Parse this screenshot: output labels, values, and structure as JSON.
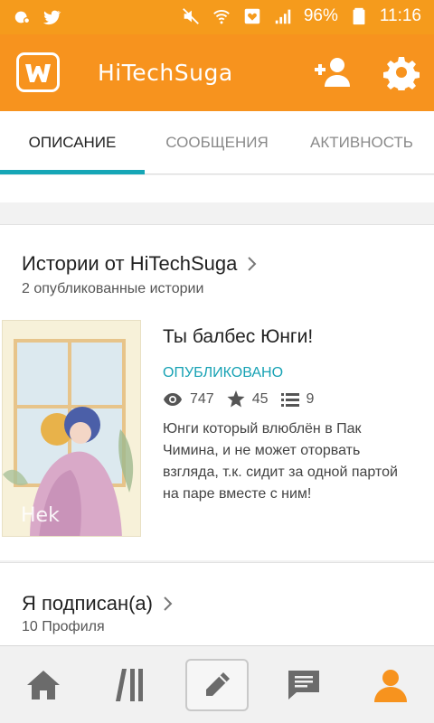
{
  "status_bar": {
    "battery": "96%",
    "time": "11:16"
  },
  "app_bar": {
    "title": "HiTechSuga"
  },
  "tabs": [
    {
      "label": "ОПИСАНИЕ",
      "active": true
    },
    {
      "label": "СООБЩЕНИЯ",
      "active": false
    },
    {
      "label": "АКТИВНОСТЬ",
      "active": false
    }
  ],
  "stories_section": {
    "title": "Истории от HiTechSuga",
    "subtitle": "2 опубликованные истории",
    "story": {
      "title": "Ты балбес Юнги!",
      "status": "ОПУБЛИКОВАНО",
      "views": "747",
      "votes": "45",
      "parts": "9",
      "description": "Юнги который влюблён в Пак Чимина, и не может оторвать взгляда, т.к. сидит за одной партой на паре вместе с ним!",
      "cover_text": "Hek"
    }
  },
  "following_section": {
    "title": "Я подписан(а)",
    "subtitle": "10 Профиля"
  },
  "bottom_nav": {
    "items": [
      "home-icon",
      "library-icon",
      "write-icon",
      "messages-icon",
      "profile-icon"
    ],
    "active": "profile-icon"
  },
  "colors": {
    "accent": "#f7931e",
    "status_bar": "#f59b1c",
    "teal": "#16a6b6",
    "icon_gray": "#6b6b6b"
  }
}
